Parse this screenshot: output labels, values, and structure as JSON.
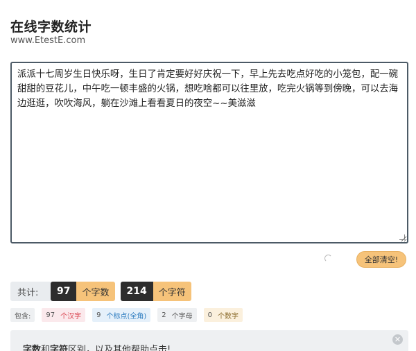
{
  "header": {
    "title": "在线字数统计",
    "subtitle": "www.EtestE.com"
  },
  "editor": {
    "text": "派派十七周岁生日快乐呀，生日了肯定要好好庆祝一下，早上先去吃点好吃的小笼包，配一碗甜甜的豆花儿，中午吃一顿丰盛的火锅，想吃啥都可以往里放，吃完火锅等到傍晚，可以去海边逛逛，吹吹海风，躺在沙滩上看看夏日的夜空~~美滋滋"
  },
  "actions": {
    "clear_label": "全部清空!"
  },
  "totals": {
    "label": "共计:",
    "chars": {
      "value": "97",
      "unit": "个字数"
    },
    "symbols": {
      "value": "214",
      "unit": "个字符"
    }
  },
  "details": {
    "label": "包含:",
    "han": {
      "value": "97",
      "unit": "个汉字"
    },
    "punct": {
      "value": "9",
      "unit": "个标点(全角)"
    },
    "letters": {
      "value": "2",
      "unit": "个字母"
    },
    "digits": {
      "value": "0",
      "unit": "个数字"
    }
  },
  "help": {
    "part1": "字数",
    "part2": "和",
    "part3": "字符",
    "part4": "区别，以及其他帮助点击!"
  },
  "colors": {
    "accent": "#f6c37a",
    "dark": "#2d2d2d"
  }
}
